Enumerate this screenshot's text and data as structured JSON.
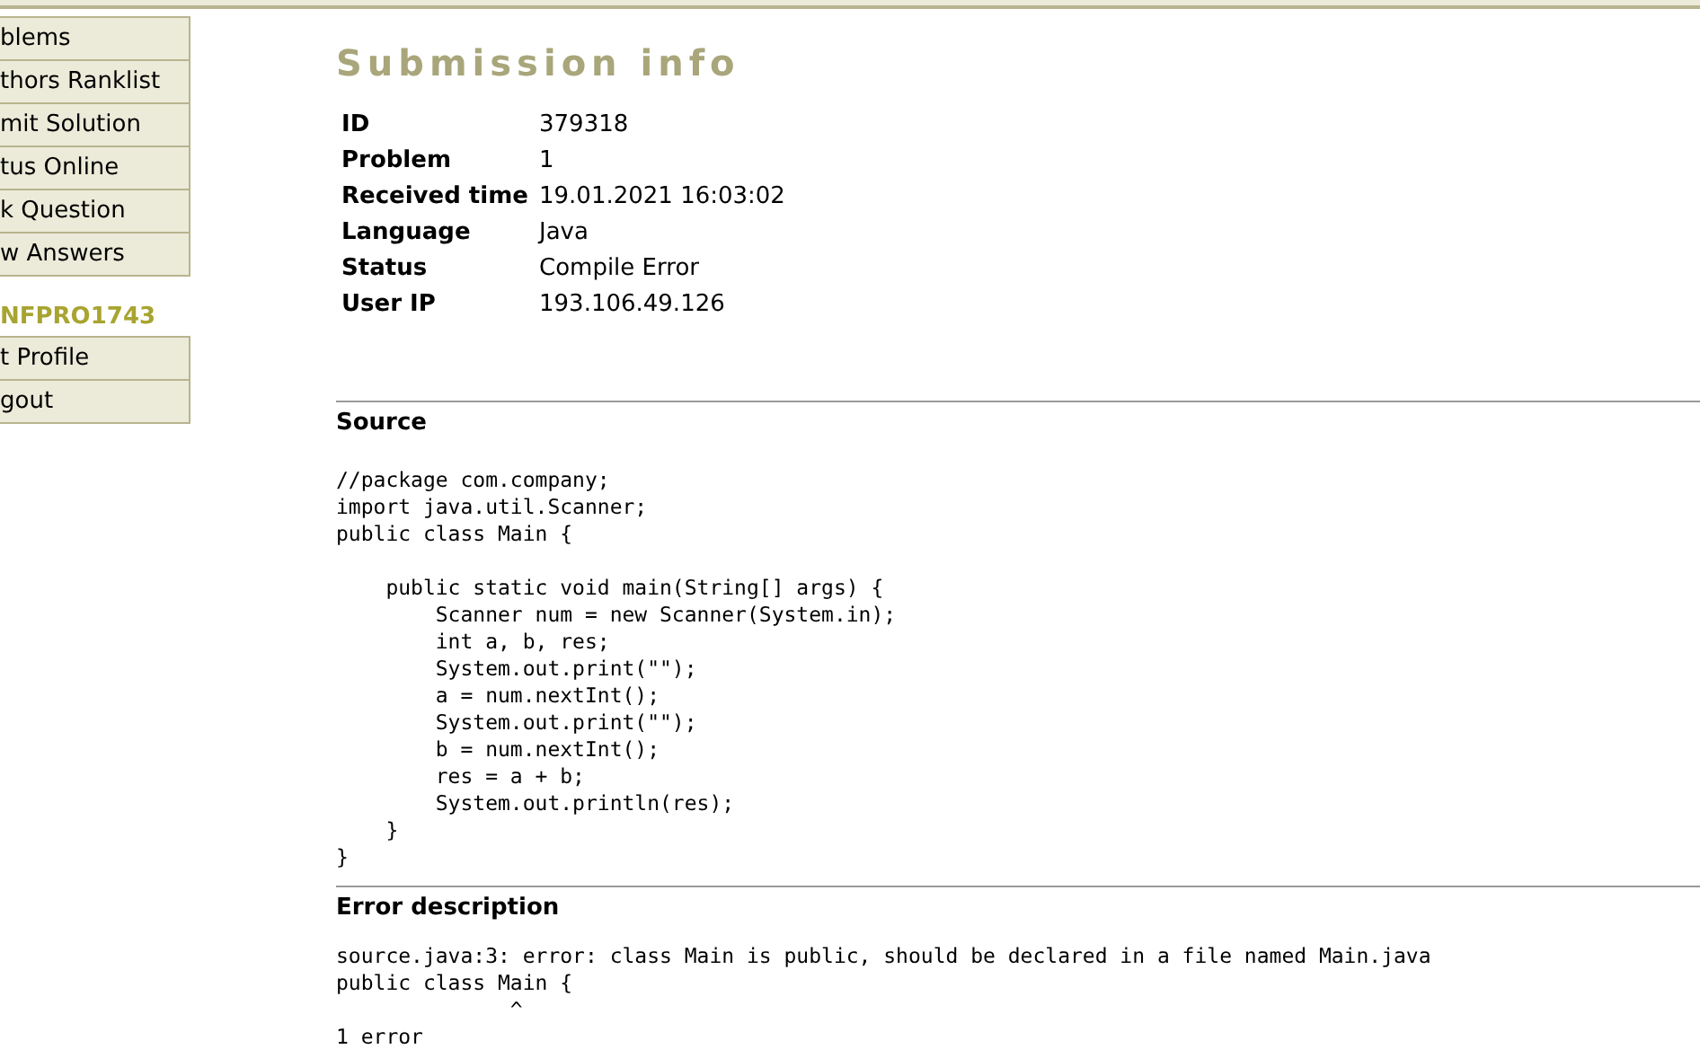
{
  "sidebar": {
    "menu": [
      "blems",
      "thors Ranklist",
      "mit Solution",
      "tus Online",
      "k Question",
      "w Answers"
    ],
    "user": "NFPRO1743",
    "user_menu": [
      "t Profile",
      "gout"
    ]
  },
  "title": "Submission info",
  "info": [
    {
      "label": "ID",
      "value": "379318"
    },
    {
      "label": "Problem",
      "value": "1"
    },
    {
      "label": "Received time",
      "value": "19.01.2021 16:03:02"
    },
    {
      "label": "Language",
      "value": "Java"
    },
    {
      "label": "Status",
      "value": "Compile Error"
    },
    {
      "label": "User IP",
      "value": "193.106.49.126"
    }
  ],
  "source": {
    "heading": "Source",
    "code": "//package com.company;\nimport java.util.Scanner;\npublic class Main {\n\n    public static void main(String[] args) {\n        Scanner num = new Scanner(System.in);\n        int a, b, res;\n        System.out.print(\"\");\n        a = num.nextInt();\n        System.out.print(\"\");\n        b = num.nextInt();\n        res = a + b;\n        System.out.println(res);\n    }\n}"
  },
  "error": {
    "heading": "Error description",
    "text": "source.java:3: error: class Main is public, should be declared in a file named Main.java\npublic class Main {\n              ^\n1 error"
  }
}
